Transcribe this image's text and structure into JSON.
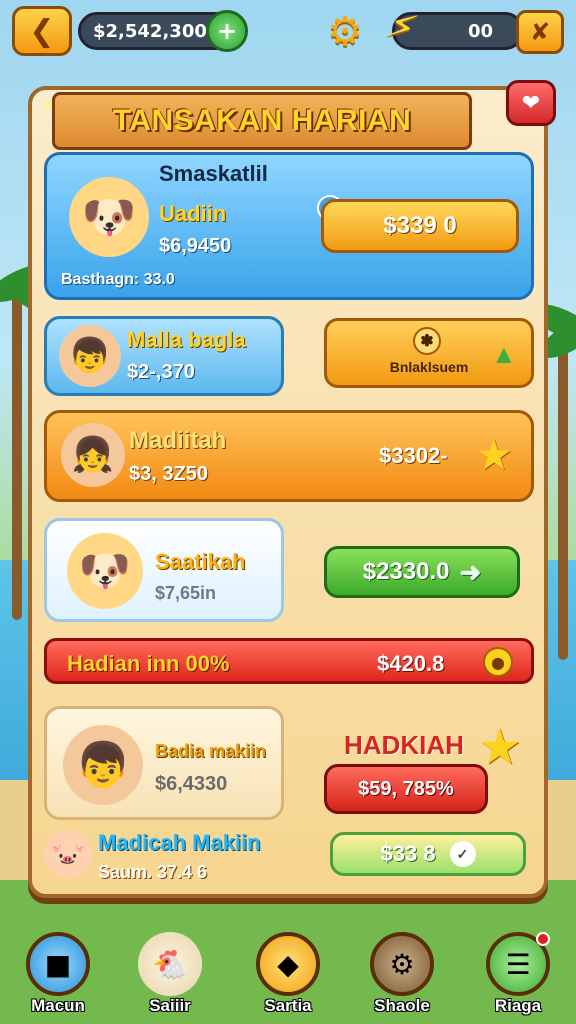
{
  "topbar": {
    "cash": "$2,542,300",
    "energy": "00"
  },
  "panel": {
    "title": "TANSAKAN HARIAN"
  },
  "cards": [
    {
      "name": "Smaskatlil",
      "subtitle": "Uadiin",
      "amount": "$6,9450",
      "footer": "Basthagn: 33.0",
      "button": "$339 0"
    },
    {
      "name": "Malla bagla",
      "amount": "$2-,370",
      "button": "Bnlaklsuem"
    },
    {
      "name": "Madiitah",
      "amount": "$3, 3Z50",
      "button": "$3302-"
    },
    {
      "name": "Saatikah",
      "amount": "$7,65in",
      "button": "$2330.0"
    },
    {
      "name": "Hadian inn 00%",
      "button": "$420.8"
    },
    {
      "name": "Badia makiin",
      "amount": "$6,4330",
      "badge": "HADKIAH",
      "button": "$59, 785%"
    },
    {
      "name": "Madicah Makiin",
      "footer": "Saum. 37.4 6",
      "button": "$33 8"
    }
  ],
  "nav": [
    {
      "label": "Macun",
      "icon": "cube-icon"
    },
    {
      "label": "Saiiir",
      "icon": "chicken-icon"
    },
    {
      "label": "Sartia",
      "icon": "kite-icon"
    },
    {
      "label": "Shaole",
      "icon": "cog-icon"
    },
    {
      "label": "Riaga",
      "icon": "scroll-icon"
    }
  ]
}
